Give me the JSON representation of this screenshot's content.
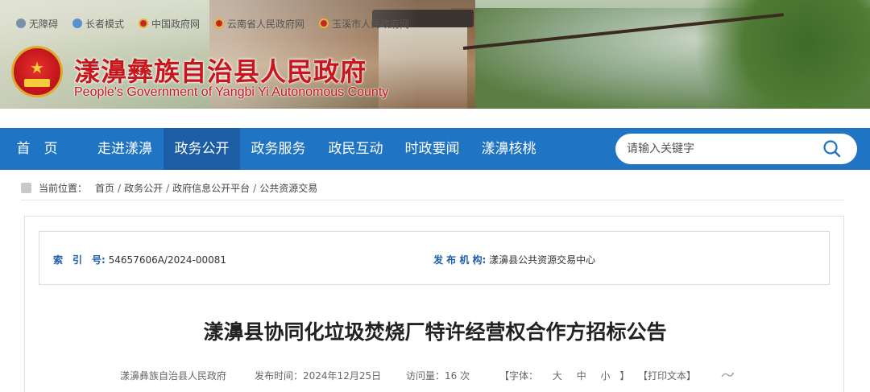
{
  "topbar": {
    "accessibility": "无障碍",
    "elder_mode": "长者模式",
    "links": [
      "中国政府网",
      "云南省人民政府网",
      "玉溪市人民政府网"
    ]
  },
  "site": {
    "title": "漾濞彝族自治县人民政府",
    "subtitle": "People's Government of Yangbi Yi Autonomous County"
  },
  "nav": {
    "items": [
      "首　页",
      "走进漾濞",
      "政务公开",
      "政务服务",
      "政民互动",
      "时政要闻",
      "漾濞核桃"
    ],
    "active_index": 2
  },
  "search": {
    "placeholder": "请输入关键字"
  },
  "breadcrumb": {
    "label": "当前位置：",
    "items": [
      "首页",
      "政务公开",
      "政府信息公开平台",
      "公共资源交易"
    ]
  },
  "meta": {
    "index_label": "索　引　号:",
    "index_value": "54657606A/2024-00081",
    "publisher_label": "发 布 机 构:",
    "publisher_value": "漾濞县公共资源交易中心"
  },
  "article": {
    "title": "漾濞县协同化垃圾焚烧厂特许经营权合作方招标公告",
    "source": "漾濞彝族自治县人民政府",
    "date_label": "发布时间：",
    "date": "2024年12月25日",
    "views_label": "访问量：",
    "views": "16 次",
    "font_label": "【字体：",
    "font_large": "大",
    "font_medium": "中",
    "font_small": "小",
    "font_close": "】",
    "print": "【打印文本】"
  },
  "colors": {
    "nav_bg": "#1f74c4",
    "nav_active": "#1b5ea6",
    "title_red": "#c8161d",
    "meta_key_blue": "#1f5fae"
  }
}
